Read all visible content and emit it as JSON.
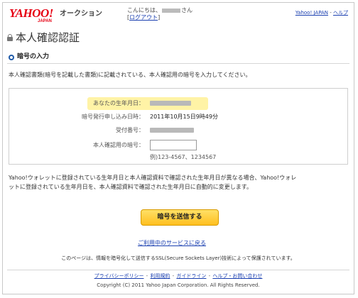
{
  "header": {
    "logo_text": "YAHOO!",
    "logo_sub": "JAPAN",
    "service_name": "オークション",
    "greeting_prefix": "こんにちは、",
    "greeting_suffix": "さん",
    "logout_label": "ログアウト",
    "yahoo_japan_link": "Yahoo! JAPAN",
    "help_link": "ヘルプ",
    "separator": " - "
  },
  "page": {
    "title": "本人確認認証",
    "section_heading": "暗号の入力",
    "instruction": "本人確認書類(暗号を記載した書類)に記載されている、本人確認用の暗号を入力してください。"
  },
  "form": {
    "birthdate_label": "あなたの生年月日：",
    "issue_date_label": "暗号発行申し込み日時：",
    "issue_date_value": "2011年10月15日9時49分",
    "receipt_label": "受付番号：",
    "pin_label": "本人確認用の暗号：",
    "pin_value": "",
    "pin_example": "例)123-4567、1234567"
  },
  "notice": {
    "line1": "Yahoo!ウォレットに登録されている生年月日と本人確認資料で確認された生年月日が異なる場合、Yahoo!ウォレ",
    "line2": "ットに登録されている生年月日を、本人確認資料で確認された生年月日に自動的に変更します。"
  },
  "actions": {
    "submit_label": "暗号を送信する",
    "back_link": "ご利用中のサービスに戻る"
  },
  "ssl_note": "このページは、情報を暗号化して送信するSSL(Secure Sockets Layer)技術によって保護されています。",
  "footer": {
    "links": [
      "プライバシーポリシー",
      "利用規約",
      "ガイドライン",
      "ヘルプ・お問い合わせ"
    ],
    "separator": " - ",
    "copyright": "Copyright (C) 2011 Yahoo Japan Corporation. All Rights Reserved."
  },
  "colors": {
    "logo_red": "#e60012",
    "link_blue": "#1a3fb0",
    "button_yellow": "#ffcf3a",
    "highlight_yellow": "#fff3a6"
  },
  "icons": {
    "title_icon": "lock-icon",
    "section_icon": "circle-bullet-icon"
  }
}
